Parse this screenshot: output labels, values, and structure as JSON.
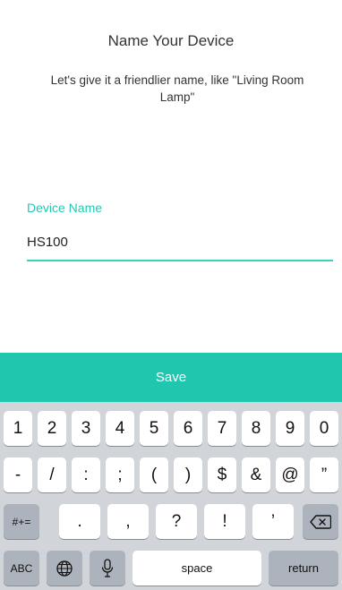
{
  "header": {
    "title": "Name Your Device"
  },
  "subtitle": "Let's give it a friendlier name, like \"Living Room Lamp\"",
  "form": {
    "label": "Device Name",
    "value": "HS100"
  },
  "save_label": "Save",
  "keyboard": {
    "row1": [
      "1",
      "2",
      "3",
      "4",
      "5",
      "6",
      "7",
      "8",
      "9",
      "0"
    ],
    "row2": [
      "-",
      "/",
      ":",
      ";",
      "(",
      ")",
      "$",
      "&",
      "@",
      "”"
    ],
    "row3_mode": "#+=",
    "row3": [
      ".",
      ",",
      "?",
      "!",
      "’"
    ],
    "abc": "ABC",
    "space": "space",
    "return": "return"
  },
  "colors": {
    "accent": "#21c6ae",
    "label": "#25c9b3",
    "keyboard_bg": "#d1d4d9"
  },
  "icons": [
    "globe-icon",
    "microphone-icon",
    "backspace-icon"
  ]
}
